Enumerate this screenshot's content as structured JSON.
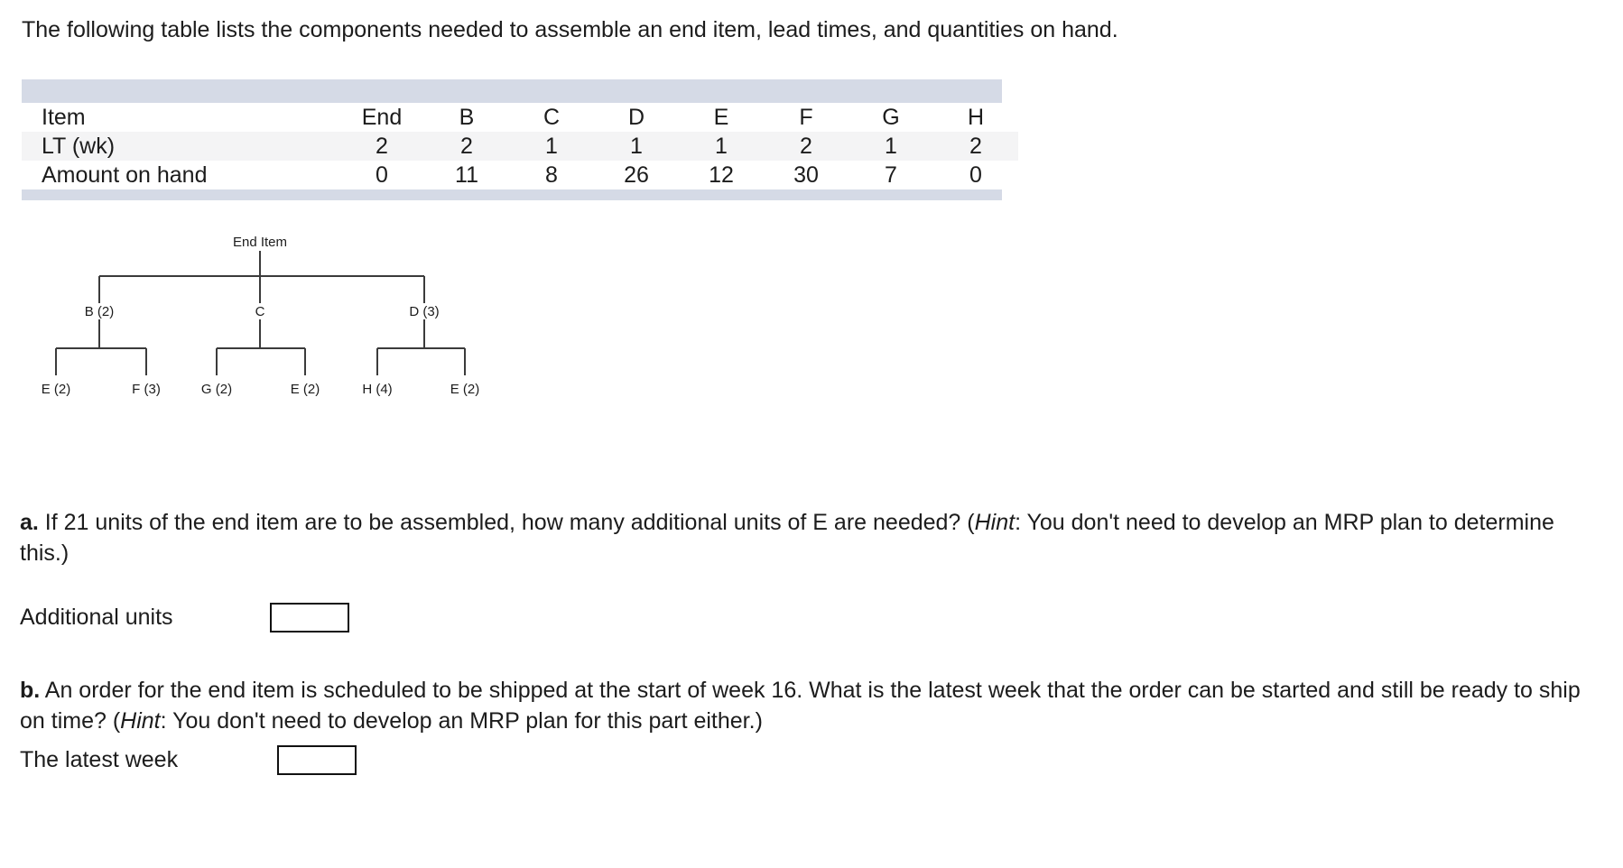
{
  "intro": {
    "text": "The following table lists the components needed to assemble an end item, lead times, and quantities on hand."
  },
  "table": {
    "row_labels": [
      "Item",
      "LT (wk)",
      "Amount on hand"
    ],
    "columns": [
      "End",
      "B",
      "C",
      "D",
      "E",
      "F",
      "G",
      "H"
    ],
    "lead_times": [
      "2",
      "2",
      "1",
      "1",
      "1",
      "2",
      "1",
      "2"
    ],
    "amount_on_hand": [
      "0",
      "11",
      "8",
      "26",
      "12",
      "30",
      "7",
      "0"
    ],
    "header_bar_color": "#d5dae6",
    "stripe_color": "#f4f4f5"
  },
  "tree": {
    "root": "End Item",
    "level1": [
      "B (2)",
      "C",
      "D (3)"
    ],
    "level2": [
      "E (2)",
      "F (3)",
      "G (2)",
      "E (2)",
      "H (4)",
      "E (2)"
    ],
    "line_color": "#3b3b3b"
  },
  "questions": {
    "a": {
      "label": "a.",
      "text_before_hint": " If 21 units of the end item are to be assembled, how many additional units of E are needed? (",
      "hint_word": "Hint",
      "text_after_hint": ": You don't need to develop an MRP plan to determine this.)"
    },
    "b": {
      "label": "b.",
      "text_before_hint": " An order for the end item is scheduled to be shipped at the start of week 16. What is the latest week that the order can be started and still be ready to ship on time? (",
      "hint_word": "Hint",
      "text_after_hint": ": You don't need to develop an MRP plan for this part either.)"
    }
  },
  "answers": {
    "a": {
      "label": "Additional units",
      "value": "",
      "placeholder": ""
    },
    "b": {
      "label": "The latest week",
      "value": "",
      "placeholder": ""
    }
  }
}
